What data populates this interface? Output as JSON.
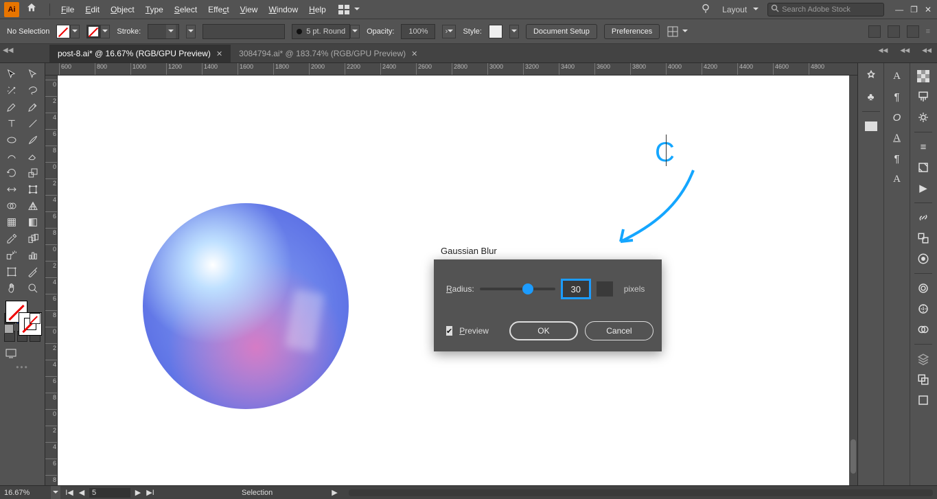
{
  "menu": {
    "items": [
      "File",
      "Edit",
      "Object",
      "Type",
      "Select",
      "Effect",
      "View",
      "Window",
      "Help"
    ],
    "layout_label": "Layout",
    "search_placeholder": "Search Adobe Stock"
  },
  "options": {
    "selection_status": "No Selection",
    "stroke_label": "Stroke:",
    "brush_label": "5 pt. Round",
    "opacity_label": "Opacity:",
    "opacity_value": "100%",
    "style_label": "Style:",
    "doc_setup": "Document Setup",
    "preferences": "Preferences"
  },
  "tabs": [
    {
      "label": "post-8.ai* @ 16.67% (RGB/GPU Preview)",
      "active": true
    },
    {
      "label": "3084794.ai* @ 183.74% (RGB/GPU Preview)",
      "active": false
    }
  ],
  "ruler": {
    "h": [
      "600",
      "800",
      "1000",
      "1200",
      "1400",
      "1600",
      "1800",
      "2000",
      "2200",
      "2400",
      "2600",
      "2800",
      "3000",
      "3200",
      "3400",
      "3600",
      "3800",
      "4000",
      "4200",
      "4400",
      "4600",
      "4800"
    ],
    "v": [
      "0",
      "2",
      "4",
      "6",
      "8",
      "0",
      "2",
      "4",
      "6",
      "8",
      "0",
      "2",
      "4",
      "6",
      "8",
      "0",
      "2",
      "4",
      "6",
      "8",
      "0",
      "2",
      "4",
      "6",
      "8"
    ]
  },
  "annotation": {
    "letter": "C"
  },
  "dialog": {
    "title": "Gaussian Blur",
    "radius_label": "Radius:",
    "radius_value": "30",
    "units": "pixels",
    "preview_label": "Preview",
    "preview_checked": true,
    "ok": "OK",
    "cancel": "Cancel"
  },
  "status": {
    "zoom": "16.67%",
    "artboard_no": "5",
    "tool": "Selection"
  }
}
